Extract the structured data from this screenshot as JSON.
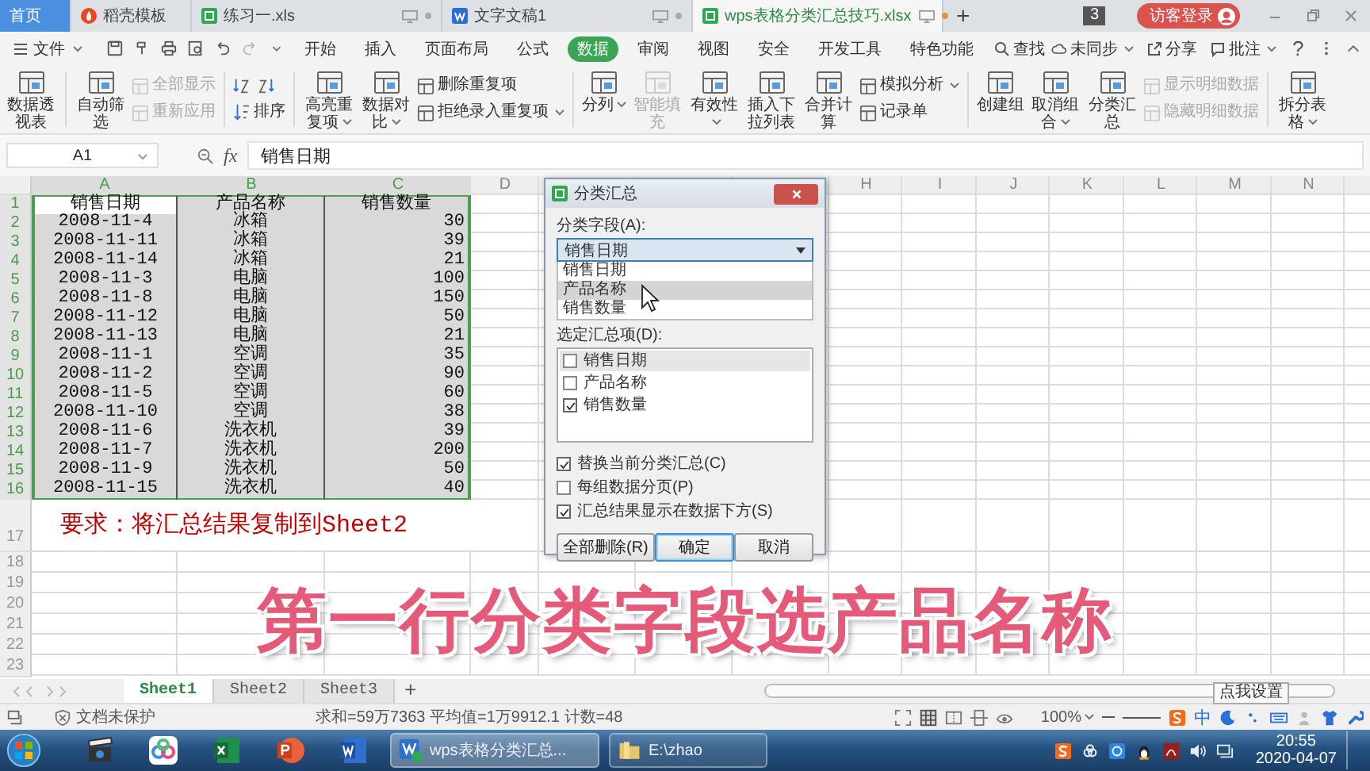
{
  "title_tabs": [
    {
      "label": "首页",
      "kind": "home",
      "selected": false
    },
    {
      "label": "稻壳模板",
      "kind": "docer",
      "selected": false
    },
    {
      "label": "练习一.xls",
      "kind": "sheet",
      "selected": false
    },
    {
      "label": "文字文稿1",
      "kind": "writer",
      "selected": false
    },
    {
      "label": "wps表格分类汇总技巧.xlsx",
      "kind": "sheet",
      "selected": true
    }
  ],
  "new_tab": "+",
  "window_count": "3",
  "login": "访客登录",
  "menu": {
    "file": "文件",
    "tabs": [
      {
        "label": "开始",
        "selected": false
      },
      {
        "label": "插入",
        "selected": false
      },
      {
        "label": "页面布局",
        "selected": false
      },
      {
        "label": "公式",
        "selected": false
      },
      {
        "label": "数据",
        "selected": true
      },
      {
        "label": "审阅",
        "selected": false
      },
      {
        "label": "视图",
        "selected": false
      },
      {
        "label": "安全",
        "selected": false
      },
      {
        "label": "开发工具",
        "selected": false
      },
      {
        "label": "特色功能",
        "selected": false
      }
    ],
    "search": "查找",
    "right_items": [
      {
        "label": "未同步",
        "kind": "cloud",
        "dropdown": true
      },
      {
        "label": "分享",
        "kind": "share",
        "dropdown": false
      },
      {
        "label": "批注",
        "kind": "comment",
        "dropdown": true
      }
    ],
    "help": "?"
  },
  "ribbon": {
    "groups": [
      [
        {
          "kind": "big",
          "items": [
            {
              "label": "数据透视表",
              "disabled": false,
              "dropdown": false
            }
          ]
        }
      ],
      [
        {
          "kind": "big",
          "items": [
            {
              "label": "自动筛选",
              "disabled": false,
              "dropdown": false
            }
          ]
        },
        {
          "kind": "stack",
          "items": [
            {
              "label": "全部显示",
              "disabled": true,
              "dropdown": false
            },
            {
              "label": "重新应用",
              "disabled": true,
              "dropdown": false
            }
          ]
        }
      ],
      [
        {
          "kind": "sort",
          "items": [
            {
              "label": "排序",
              "disabled": false,
              "dropdown": false
            }
          ]
        }
      ],
      [
        {
          "kind": "big",
          "items": [
            {
              "label": "高亮重复项",
              "disabled": false,
              "dropdown": true
            }
          ]
        },
        {
          "kind": "big",
          "items": [
            {
              "label": "数据对比",
              "disabled": false,
              "dropdown": true
            }
          ]
        },
        {
          "kind": "stack",
          "items": [
            {
              "label": "删除重复项",
              "disabled": false,
              "dropdown": false
            },
            {
              "label": "拒绝录入重复项",
              "disabled": false,
              "dropdown": true
            }
          ]
        }
      ],
      [
        {
          "kind": "big",
          "items": [
            {
              "label": "分列",
              "disabled": false,
              "dropdown": true
            }
          ]
        },
        {
          "kind": "big",
          "items": [
            {
              "label": "智能填充",
              "disabled": true,
              "dropdown": false
            }
          ]
        },
        {
          "kind": "big",
          "items": [
            {
              "label": "有效性",
              "disabled": false,
              "dropdown": true
            }
          ]
        },
        {
          "kind": "big",
          "items": [
            {
              "label": "插入下拉列表",
              "disabled": false,
              "dropdown": false
            }
          ]
        },
        {
          "kind": "big",
          "items": [
            {
              "label": "合并计算",
              "disabled": false,
              "dropdown": false
            }
          ]
        },
        {
          "kind": "stack",
          "items": [
            {
              "label": "模拟分析",
              "disabled": false,
              "dropdown": true
            },
            {
              "label": "记录单",
              "disabled": false,
              "dropdown": false
            }
          ]
        }
      ],
      [
        {
          "kind": "big",
          "items": [
            {
              "label": "创建组",
              "disabled": false,
              "dropdown": false
            }
          ]
        },
        {
          "kind": "big",
          "items": [
            {
              "label": "取消组合",
              "disabled": false,
              "dropdown": true
            }
          ]
        },
        {
          "kind": "big",
          "items": [
            {
              "label": "分类汇总",
              "disabled": false,
              "dropdown": false
            }
          ]
        },
        {
          "kind": "stack",
          "items": [
            {
              "label": "显示明细数据",
              "disabled": true,
              "dropdown": false
            },
            {
              "label": "隐藏明细数据",
              "disabled": true,
              "dropdown": false
            }
          ]
        }
      ],
      [
        {
          "kind": "big",
          "items": [
            {
              "label": "拆分表格",
              "disabled": false,
              "dropdown": true
            }
          ]
        }
      ]
    ]
  },
  "formula": {
    "name_box": "A1",
    "fx": "fx",
    "value": "销售日期"
  },
  "sheet": {
    "columns_left": [
      "A",
      "B",
      "C",
      "D"
    ],
    "columns_right": [
      "H",
      "I",
      "J",
      "K",
      "L",
      "M",
      "N"
    ],
    "rows": [
      {
        "n": "1",
        "kind": "header",
        "selected": true,
        "cells": [
          {
            "text": "销售日期",
            "active": true
          },
          {
            "text": "产品名称",
            "active": false
          },
          {
            "text": "销售数量",
            "active": false
          }
        ]
      },
      {
        "n": "2",
        "kind": "data",
        "selected": true,
        "cells": [
          {
            "text": "2008-11-4",
            "active": false
          },
          {
            "text": "冰箱",
            "active": false
          },
          {
            "text": "30",
            "active": false
          }
        ]
      },
      {
        "n": "3",
        "kind": "data",
        "selected": true,
        "cells": [
          {
            "text": "2008-11-11",
            "active": false
          },
          {
            "text": "冰箱",
            "active": false
          },
          {
            "text": "39",
            "active": false
          }
        ]
      },
      {
        "n": "4",
        "kind": "data",
        "selected": true,
        "cells": [
          {
            "text": "2008-11-14",
            "active": false
          },
          {
            "text": "冰箱",
            "active": false
          },
          {
            "text": "21",
            "active": false
          }
        ]
      },
      {
        "n": "5",
        "kind": "data",
        "selected": true,
        "cells": [
          {
            "text": "2008-11-3",
            "active": false
          },
          {
            "text": "电脑",
            "active": false
          },
          {
            "text": "100",
            "active": false
          }
        ]
      },
      {
        "n": "6",
        "kind": "data",
        "selected": true,
        "cells": [
          {
            "text": "2008-11-8",
            "active": false
          },
          {
            "text": "电脑",
            "active": false
          },
          {
            "text": "150",
            "active": false
          }
        ]
      },
      {
        "n": "7",
        "kind": "data",
        "selected": true,
        "cells": [
          {
            "text": "2008-11-12",
            "active": false
          },
          {
            "text": "电脑",
            "active": false
          },
          {
            "text": "50",
            "active": false
          }
        ]
      },
      {
        "n": "8",
        "kind": "data",
        "selected": true,
        "cells": [
          {
            "text": "2008-11-13",
            "active": false
          },
          {
            "text": "电脑",
            "active": false
          },
          {
            "text": "21",
            "active": false
          }
        ]
      },
      {
        "n": "9",
        "kind": "data",
        "selected": true,
        "cells": [
          {
            "text": "2008-11-1",
            "active": false
          },
          {
            "text": "空调",
            "active": false
          },
          {
            "text": "35",
            "active": false
          }
        ]
      },
      {
        "n": "10",
        "kind": "data",
        "selected": true,
        "cells": [
          {
            "text": "2008-11-2",
            "active": false
          },
          {
            "text": "空调",
            "active": false
          },
          {
            "text": "90",
            "active": false
          }
        ]
      },
      {
        "n": "11",
        "kind": "data",
        "selected": true,
        "cells": [
          {
            "text": "2008-11-5",
            "active": false
          },
          {
            "text": "空调",
            "active": false
          },
          {
            "text": "60",
            "active": false
          }
        ]
      },
      {
        "n": "12",
        "kind": "data",
        "selected": true,
        "cells": [
          {
            "text": "2008-11-10",
            "active": false
          },
          {
            "text": "空调",
            "active": false
          },
          {
            "text": "38",
            "active": false
          }
        ]
      },
      {
        "n": "13",
        "kind": "data",
        "selected": true,
        "cells": [
          {
            "text": "2008-11-6",
            "active": false
          },
          {
            "text": "洗衣机",
            "active": false
          },
          {
            "text": "39",
            "active": false
          }
        ]
      },
      {
        "n": "14",
        "kind": "data",
        "selected": true,
        "cells": [
          {
            "text": "2008-11-7",
            "active": false
          },
          {
            "text": "洗衣机",
            "active": false
          },
          {
            "text": "200",
            "active": false
          }
        ]
      },
      {
        "n": "15",
        "kind": "data",
        "selected": true,
        "cells": [
          {
            "text": "2008-11-9",
            "active": false
          },
          {
            "text": "洗衣机",
            "active": false
          },
          {
            "text": "50",
            "active": false
          }
        ]
      },
      {
        "n": "16",
        "kind": "data",
        "selected": true,
        "cells": [
          {
            "text": "2008-11-15",
            "active": false
          },
          {
            "text": "洗衣机",
            "active": false
          },
          {
            "text": "40",
            "active": false
          }
        ]
      }
    ],
    "note": {
      "n": "17",
      "text": "要求：将汇总结果复制到Sheet2"
    },
    "empty_rows": [
      "18",
      "19",
      "20",
      "21",
      "22",
      "23"
    ]
  },
  "dialog": {
    "title": "分类汇总",
    "field_label": "分类字段(A):",
    "field_value": "销售日期",
    "options": [
      {
        "label": "销售日期",
        "highlighted": false
      },
      {
        "label": "产品名称",
        "highlighted": true
      },
      {
        "label": "销售数量",
        "highlighted": false
      }
    ],
    "summary_label": "选定汇总项(D):",
    "summary_items": [
      {
        "label": "销售日期",
        "checked": false,
        "highlighted": true
      },
      {
        "label": "产品名称",
        "checked": false,
        "highlighted": false
      },
      {
        "label": "销售数量",
        "checked": true,
        "highlighted": false
      }
    ],
    "settings": [
      {
        "label": "替换当前分类汇总(C)",
        "checked": true
      },
      {
        "label": "每组数据分页(P)",
        "checked": false
      },
      {
        "label": "汇总结果显示在数据下方(S)",
        "checked": true
      }
    ],
    "buttons": [
      {
        "label": "全部删除(R)",
        "default": false
      },
      {
        "label": "确定",
        "default": true
      },
      {
        "label": "取消",
        "default": false
      }
    ]
  },
  "caption": "第一行分类字段选产品名称",
  "sheet_tabs": [
    {
      "label": "Sheet1",
      "selected": true
    },
    {
      "label": "Sheet2",
      "selected": false
    },
    {
      "label": "Sheet3",
      "selected": false
    }
  ],
  "add_sheet": "+",
  "tooltip": "点我设置",
  "status": {
    "protection": "文档未保护",
    "stats": "求和=59万7363 平均值=1万9912.1 计数=48",
    "zoom": "100%",
    "zoom_slider": {
      "level": 1
    },
    "ime": "中"
  },
  "taskbar": {
    "tasks": [
      {
        "label": "wps表格分类汇总...",
        "kind": "wps",
        "selected": true
      },
      {
        "label": "E:\\zhao",
        "kind": "folder",
        "selected": false
      }
    ],
    "time": "20:55",
    "date": "2020-04-07"
  }
}
